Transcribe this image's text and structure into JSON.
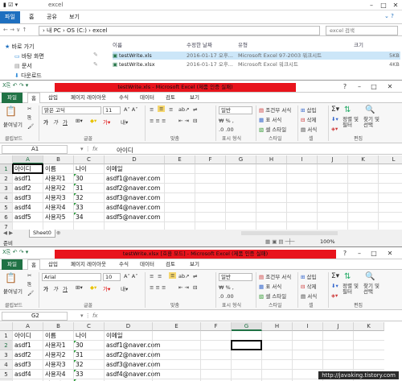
{
  "explorer": {
    "title": "excel",
    "tabs": [
      "파일",
      "홈",
      "공유",
      "보기"
    ],
    "address": "› 내 PC › OS (C:) › excel",
    "search_placeholder": "excel 검색",
    "nav": [
      "바로 가기",
      "바탕 화면",
      "문서",
      "다운로드"
    ],
    "columns": [
      "이름",
      "수정한 날짜",
      "유형",
      "크기"
    ],
    "files": [
      {
        "name": "testWrite.xls",
        "date": "2016-01-17 오후...",
        "type": "Microsoft Excel 97-2003 워크시트",
        "size": "5KB"
      },
      {
        "name": "testWrite.xlsx",
        "date": "2016-01-17 오후...",
        "type": "Microsoft Excel 워크시트",
        "size": "4KB"
      }
    ]
  },
  "excel1": {
    "title": "testWrite.xls - Microsoft Excel (제품 인증 실패)",
    "tabs": [
      "파일",
      "홈",
      "삽입",
      "페이지 레이아웃",
      "수식",
      "데이터",
      "검토",
      "보기"
    ],
    "font": "맑은 고딕",
    "size": "11",
    "numfmt": "일반",
    "namebox": "A1",
    "formula": "아이디",
    "status_left": "준비",
    "sheet": "Sheet0",
    "zoom": "100%",
    "columns": [
      "A",
      "B",
      "C",
      "D",
      "E",
      "F",
      "G",
      "H",
      "I",
      "J",
      "K",
      "L",
      "M"
    ],
    "rows": [
      [
        "아이디",
        "이름",
        "나이",
        "이메일"
      ],
      [
        "asdf1",
        "사용자1",
        "30",
        "asdf1@naver.com"
      ],
      [
        "asdf2",
        "사용자2",
        "31",
        "asdf2@naver.com"
      ],
      [
        "asdf3",
        "사용자3",
        "32",
        "asdf3@naver.com"
      ],
      [
        "asdf4",
        "사용자4",
        "33",
        "asdf4@naver.com"
      ],
      [
        "asdf5",
        "사용자5",
        "34",
        "asdf5@naver.com"
      ]
    ]
  },
  "excel2": {
    "title": "testWrite.xlsx [호환 모드] - Microsoft Excel (제품 인증 실패)",
    "tabs": [
      "파일",
      "홈",
      "삽입",
      "페이지 레이아웃",
      "수식",
      "데이터",
      "검토",
      "보기"
    ],
    "font": "Arial",
    "size": "10",
    "numfmt": "일반",
    "namebox": "G2",
    "formula": "",
    "columns": [
      "A",
      "B",
      "C",
      "D",
      "E",
      "F",
      "G",
      "H",
      "I",
      "J",
      "K"
    ],
    "rows": [
      [
        "아이디",
        "이름",
        "나이",
        "이메일"
      ],
      [
        "asdf1",
        "사용자1",
        "30",
        "asdf1@naver.com"
      ],
      [
        "asdf2",
        "사용자2",
        "31",
        "asdf2@naver.com"
      ],
      [
        "asdf3",
        "사용자3",
        "32",
        "asdf3@naver.com"
      ],
      [
        "asdf4",
        "사용자4",
        "33",
        "asdf4@naver.com"
      ],
      [
        "asdf5",
        "사용자5",
        "34",
        "asdf5@naver.com"
      ]
    ]
  },
  "ribbon": {
    "paste": "붙여넣기",
    "clipboard": "클립보드",
    "font_group": "글꼴",
    "align_group": "맞춤",
    "number_group": "표시 형식",
    "style_group": "스타일",
    "cells_group": "셀",
    "edit_group": "편집",
    "cond_format": "조건부 서식",
    "table_format": "표 서식",
    "cell_style": "셀 스타일",
    "insert": "삽입",
    "delete": "삭제",
    "format": "서식",
    "sort": "정렬 및 필터",
    "find": "찾기 및 선택"
  },
  "watermark": "http://javaking.tistory.com",
  "colors": {
    "excel_green": "#207245",
    "red_bar": "#e8141c",
    "explorer_blue": "#1e6fbf"
  }
}
